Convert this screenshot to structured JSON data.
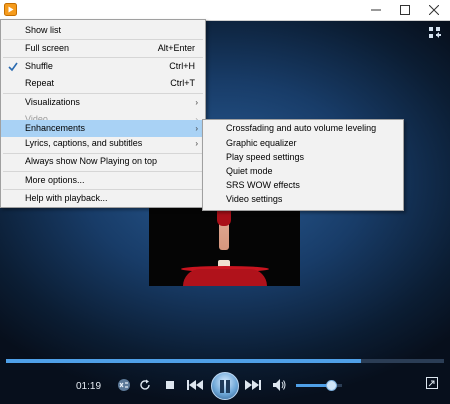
{
  "main_menu": {
    "items": [
      {
        "label": "Show list",
        "accel": ""
      },
      {
        "label": "Full screen",
        "accel": "Alt+Enter"
      },
      {
        "label": "Shuffle",
        "accel": "Ctrl+H",
        "checked": true
      },
      {
        "label": "Repeat",
        "accel": "Ctrl+T"
      },
      {
        "label": "Visualizations",
        "submenu": true
      },
      {
        "label": "Video",
        "submenu": true,
        "disabled": true
      },
      {
        "label": "Enhancements",
        "submenu": true,
        "highlighted": true
      },
      {
        "label": "Lyrics, captions, and subtitles",
        "submenu": true
      },
      {
        "label": "Always show Now Playing on top"
      },
      {
        "label": "More options..."
      },
      {
        "label": "Help with playback..."
      }
    ]
  },
  "enhancements_menu": {
    "items": [
      {
        "label": "Crossfading and auto volume leveling"
      },
      {
        "label": "Graphic equalizer"
      },
      {
        "label": "Play speed settings"
      },
      {
        "label": "Quiet mode"
      },
      {
        "label": "SRS WOW effects"
      },
      {
        "label": "Video settings"
      }
    ]
  },
  "player": {
    "elapsed_time": "01:19",
    "seek_progress": 0.81,
    "volume_level": 0.76
  },
  "icons": {
    "app": "media-player-icon",
    "minimize": "minimize-icon",
    "maximize": "maximize-icon",
    "close": "close-icon",
    "switch_view": "switch-to-library-icon",
    "shuffle": "shuffle-icon",
    "repeat": "repeat-icon",
    "stop": "stop-icon",
    "previous": "previous-icon",
    "play_pause": "pause-icon",
    "next": "next-icon",
    "mute": "speaker-icon",
    "fullscreen": "fullscreen-icon"
  },
  "colors": {
    "highlight": "#a9d2f5",
    "menu_bg": "#f2f2f2",
    "accent": "#4fa0e8"
  }
}
